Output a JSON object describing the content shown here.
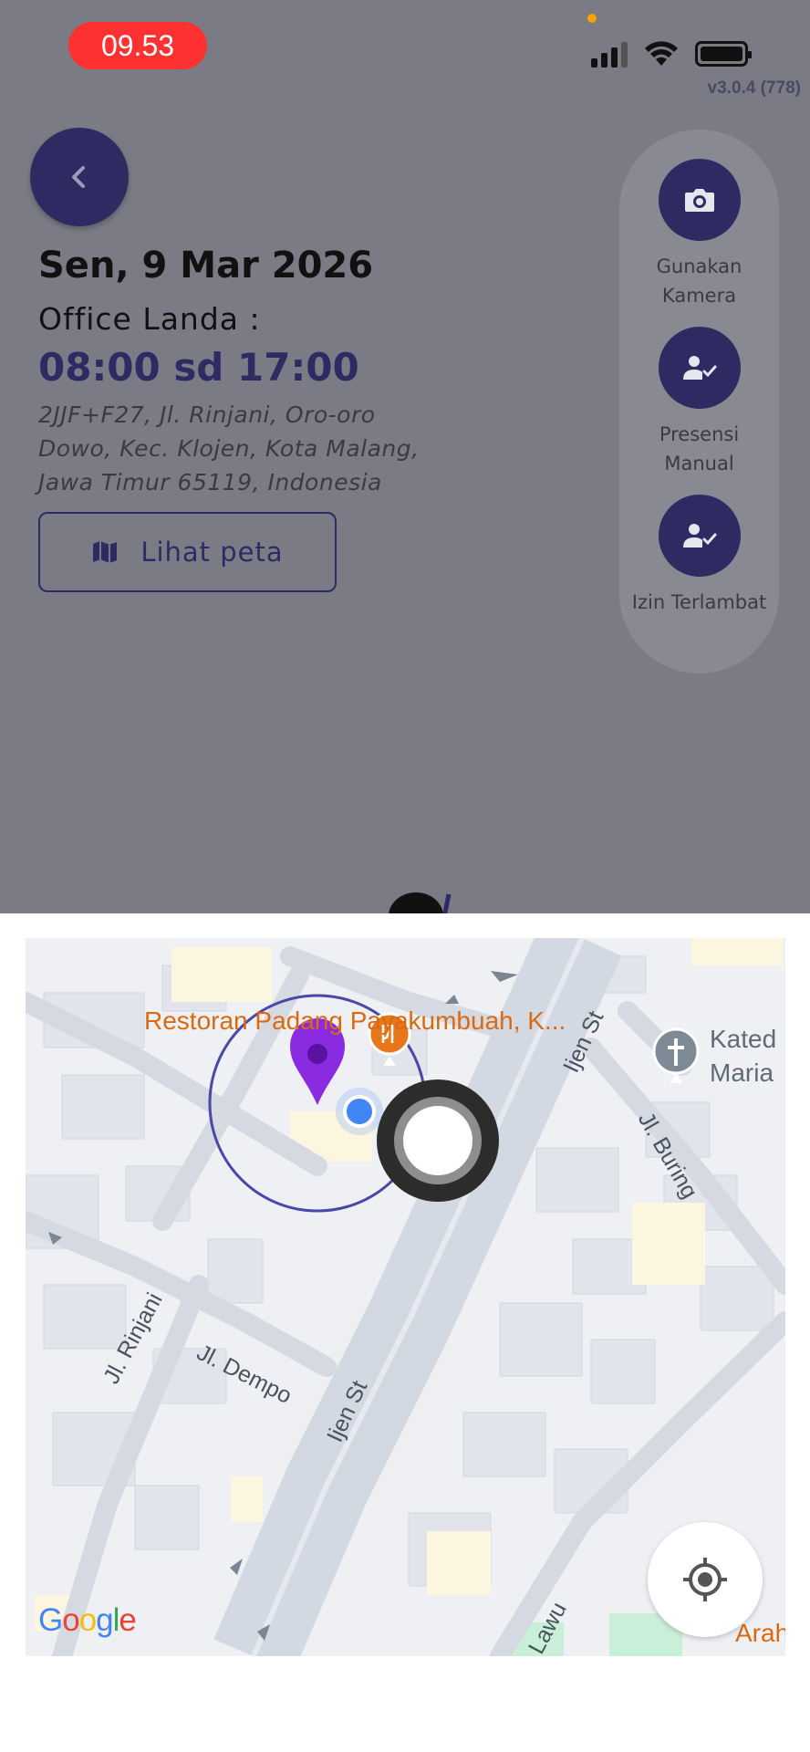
{
  "status_bar": {
    "time": "09.53",
    "version": "v3.0.4 (778)"
  },
  "schedule": {
    "date": "Sen, 9 Mar 2026",
    "office": "Office Landa :",
    "hours": "08:00 sd 17:00",
    "address": "2JJF+F27, Jl. Rinjani, Oro-oro Dowo, Kec. Klojen, Kota Malang, Jawa Timur 65119, Indonesia",
    "map_button_label": "Lihat peta"
  },
  "side_menu": [
    {
      "label": "Gunakan Kamera",
      "icon": "camera-icon"
    },
    {
      "label": "Presensi Manual",
      "icon": "user-check-icon"
    },
    {
      "label": "Izin Terlambat",
      "icon": "user-check-icon"
    }
  ],
  "map": {
    "poi_restaurant": "Restoran Padang Payakumbuah, K...",
    "poi_cathedral_line1": "Kated",
    "poi_cathedral_line2": "Maria",
    "street_ijen_top": "Ijen St",
    "street_ijen_bottom": "Ijen St",
    "street_buring": "Jl. Buring",
    "street_rinjani": "Jl. Rinjani",
    "street_dempo": "Jl. Dempo",
    "street_lawu": "Lawu",
    "poi_arah": "Arah",
    "attribution": "Google"
  },
  "colors": {
    "primary": "#2d2b62",
    "status_pill": "#ff3131",
    "poi_orange": "#e8771a",
    "marker_purple": "#8a2be2",
    "blue_dot": "#4285f4"
  }
}
